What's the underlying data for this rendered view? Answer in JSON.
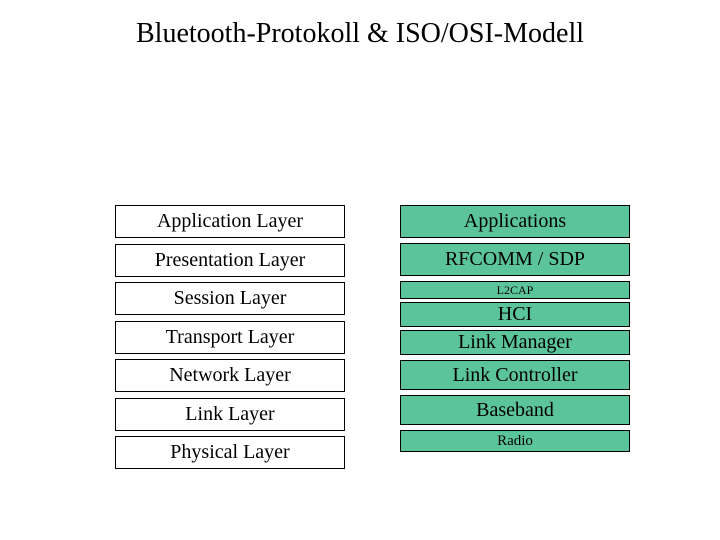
{
  "title": "Bluetooth-Protokoll & ISO/OSI-Modell",
  "osi": {
    "layers": [
      "Application Layer",
      "Presentation Layer",
      "Session Layer",
      "Transport Layer",
      "Network Layer",
      "Link Layer",
      "Physical Layer"
    ]
  },
  "bluetooth": {
    "applications": "Applications",
    "rfcomm_sdp": "RFCOMM / SDP",
    "l2cap": "L2CAP",
    "hci": "HCI",
    "link_manager": "Link Manager",
    "link_controller": "Link Controller",
    "baseband": "Baseband",
    "radio": "Radio"
  },
  "colors": {
    "bt_box": "#5cc49a",
    "osi_box": "#ffffff"
  }
}
